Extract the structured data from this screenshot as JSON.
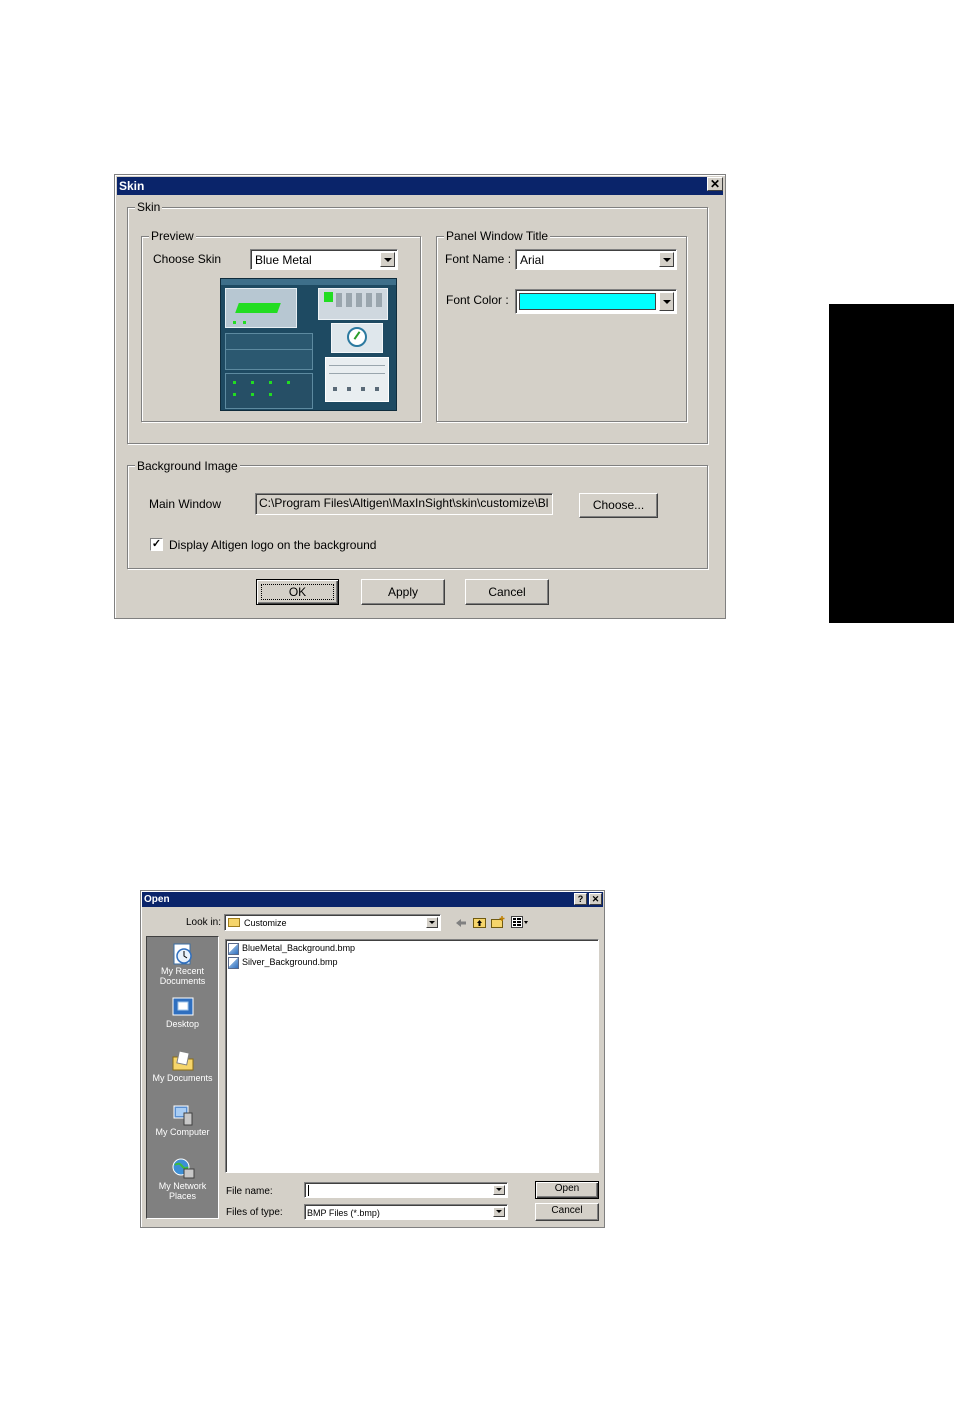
{
  "skin_dialog": {
    "title": "Skin",
    "close_glyph": "✕",
    "skin_group": "Skin",
    "preview_group": "Preview",
    "choose_skin_label": "Choose Skin",
    "choose_skin_value": "Blue Metal",
    "panel_title_group": "Panel Window Title",
    "font_name_label": "Font Name :",
    "font_name_value": "Arial",
    "font_color_label": "Font Color :",
    "font_color_value": "#00ffff",
    "bg_group": "Background Image",
    "main_window_label": "Main Window",
    "main_window_path": "C:\\Program Files\\Altigen\\MaxInSight\\skin\\customize\\Bl",
    "choose_button": "Choose...",
    "display_logo_label": "Display Altigen logo on the background",
    "display_logo_checked": true,
    "check_glyph": "✓",
    "ok_button": "OK",
    "apply_button": "Apply",
    "cancel_button": "Cancel"
  },
  "open_dialog": {
    "title": "Open",
    "help_glyph": "?",
    "close_glyph": "✕",
    "look_in_label": "Look in:",
    "look_in_value": "Customize",
    "toolbar_icons": [
      "back-arrow-icon",
      "up-folder-icon",
      "new-folder-icon",
      "view-menu-icon"
    ],
    "places": [
      {
        "label": "My Recent\nDocuments",
        "icon": "recent-documents-icon"
      },
      {
        "label": "Desktop",
        "icon": "desktop-icon"
      },
      {
        "label": "My Documents",
        "icon": "my-documents-icon"
      },
      {
        "label": "My Computer",
        "icon": "my-computer-icon"
      },
      {
        "label": "My Network\nPlaces",
        "icon": "network-places-icon"
      }
    ],
    "files": [
      "BlueMetal_Background.bmp",
      "Silver_Background.bmp"
    ],
    "file_name_label": "File name:",
    "file_name_value": "",
    "files_of_type_label": "Files of type:",
    "files_of_type_value": "BMP Files (*.bmp)",
    "open_button": "Open",
    "cancel_button": "Cancel"
  }
}
